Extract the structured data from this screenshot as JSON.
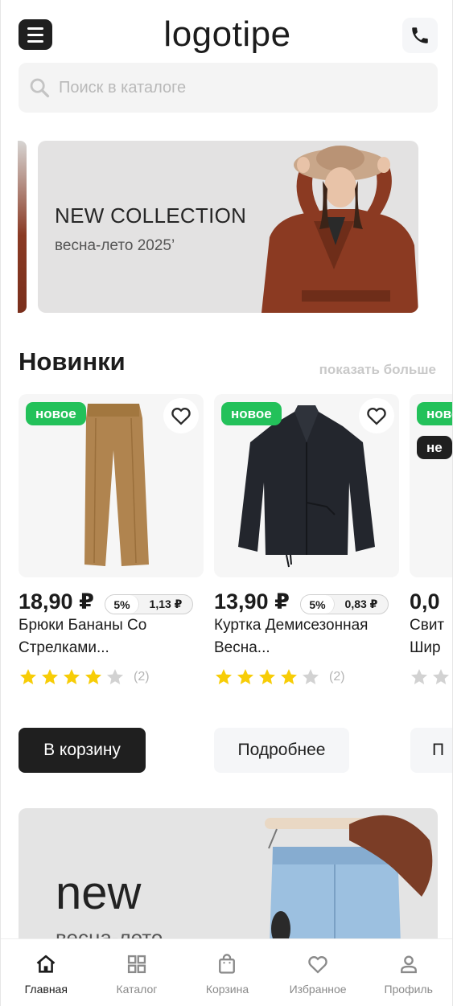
{
  "header": {
    "logo": "logotipe",
    "menu_icon": "menu-icon",
    "phone_icon": "phone-icon"
  },
  "search": {
    "placeholder": "Поиск в каталоге",
    "value": "",
    "icon": "search-icon"
  },
  "hero_banner": {
    "title": "NEW COLLECTION",
    "subtitle": "весна-лето 2025’"
  },
  "new_section": {
    "title": "Новинки",
    "more_link": "показать больше"
  },
  "products": [
    {
      "badge": "новое",
      "price": "18,90 ₽",
      "installment_percent": "5%",
      "installment_amount": "1,13 ₽",
      "name": "Брюки Бананы Со Стрелками...",
      "rating": 4,
      "reviews": "(2)",
      "cart_button": "В корзину",
      "details_button": "Подробнее"
    },
    {
      "badge": "новое",
      "price": "13,90 ₽",
      "installment_percent": "5%",
      "installment_amount": "0,83 ₽",
      "name": "Куртка Демисезонная Весна...",
      "rating": 4,
      "reviews": "(2)",
      "details_button": "Подробнее"
    },
    {
      "badge": "новое",
      "badge2": "не",
      "price": "0,0",
      "name": "Свит Шир",
      "details_button": "П"
    }
  ],
  "promo_banner": {
    "title": "new",
    "subtitle": "весна-лето"
  },
  "bottom_nav": [
    {
      "label": "Главная",
      "icon": "home-icon",
      "active": true
    },
    {
      "label": "Каталог",
      "icon": "grid-icon",
      "active": false
    },
    {
      "label": "Корзина",
      "icon": "bag-icon",
      "active": false
    },
    {
      "label": "Избранное",
      "icon": "heart-icon",
      "active": false
    },
    {
      "label": "Профиль",
      "icon": "user-icon",
      "active": false
    }
  ],
  "colors": {
    "accent_green": "#23c15a",
    "star_yellow": "#f7cd07",
    "dark": "#1f1f1f"
  }
}
